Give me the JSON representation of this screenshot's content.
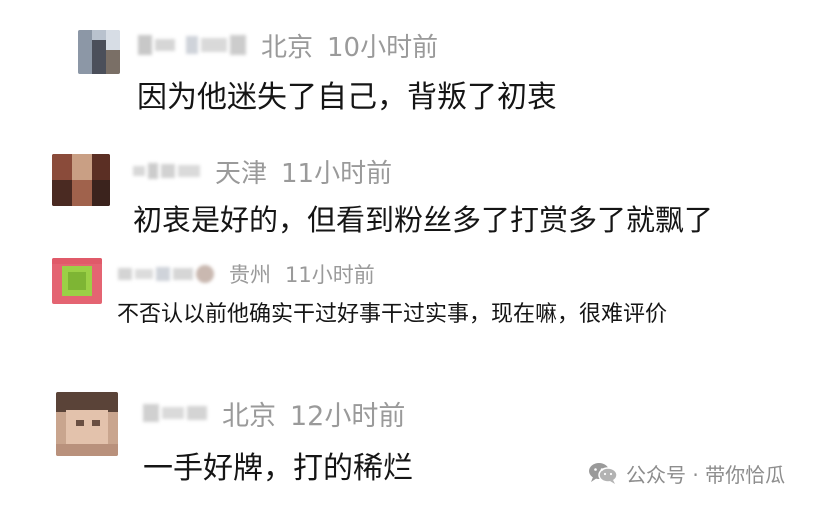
{
  "comments": [
    {
      "username": "",
      "location": "北京",
      "time": "10小时前",
      "text": "因为他迷失了自己，背叛了初衷"
    },
    {
      "username": "",
      "location": "天津",
      "time": "11小时前",
      "text": "初衷是好的，但看到粉丝多了打赏多了就飘了"
    },
    {
      "username": "",
      "location": "贵州",
      "time": "11小时前",
      "text": "不否认以前他确实干过好事干过实事，现在嘛，很难评价"
    },
    {
      "username": "",
      "location": "北京",
      "time": "12小时前",
      "text": "一手好牌，打的稀烂"
    }
  ],
  "watermark": {
    "icon": "wechat-icon",
    "text": "公众号 · 带你恰瓜"
  },
  "colors": {
    "meta": "#9a9a9a",
    "text": "#151515",
    "background": "#ffffff"
  }
}
